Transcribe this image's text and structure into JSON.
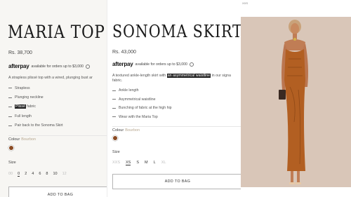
{
  "left_product": {
    "title": "Maria Top",
    "price": "Rs. 38,700",
    "afterpay_logo": "afterpay",
    "afterpay_text": "available for orders up to $3,000",
    "description_prefix": "A strapless plissé top with a wired, plunging bust ar",
    "features": [
      {
        "text": "Strapless"
      },
      {
        "text": "Plunging neckline"
      },
      {
        "highlight": "Plissé",
        "text": " fabric"
      },
      {
        "text": "Full length"
      },
      {
        "text": "Pair back to the Sonoma Skirt"
      }
    ],
    "colour_label": "Colour",
    "colour_value": "Bourbon",
    "size_label": "Size",
    "sizes": [
      "00",
      "0",
      "2",
      "4",
      "6",
      "8",
      "10",
      "12"
    ],
    "selected_size": "0",
    "add_to_bag": "ADD TO BAG"
  },
  "right_product": {
    "title": "Sonoma Skirt",
    "price": "Rs. 43,000",
    "afterpay_logo": "afterpay",
    "afterpay_text": "available for orders up to $3,000",
    "description_line1_before": "A textured ankle-length skirt with ",
    "description_highlight": "an asymmetrical waistline",
    "description_line1_after": " in our signa",
    "description_line2": "fabric.",
    "features": [
      "Ankle length",
      "Asymmetrical waistline",
      "Bunching of fabric at the high hip",
      "Wear with the Maria Top"
    ],
    "colour_label": "Colour",
    "colour_value": "Bourbon",
    "size_label": "Size",
    "sizes": [
      "XXS",
      "XS",
      "S",
      "M",
      "L",
      "XL"
    ],
    "selected_size": "XS",
    "add_to_bag": "ADD TO BAG"
  },
  "photo": {
    "crumb": "XXS",
    "background": "#d9c6b8",
    "dress_color": "#b25f22"
  },
  "colors": {
    "swatch": "#8a4a22",
    "page": "#f7f6f3"
  }
}
